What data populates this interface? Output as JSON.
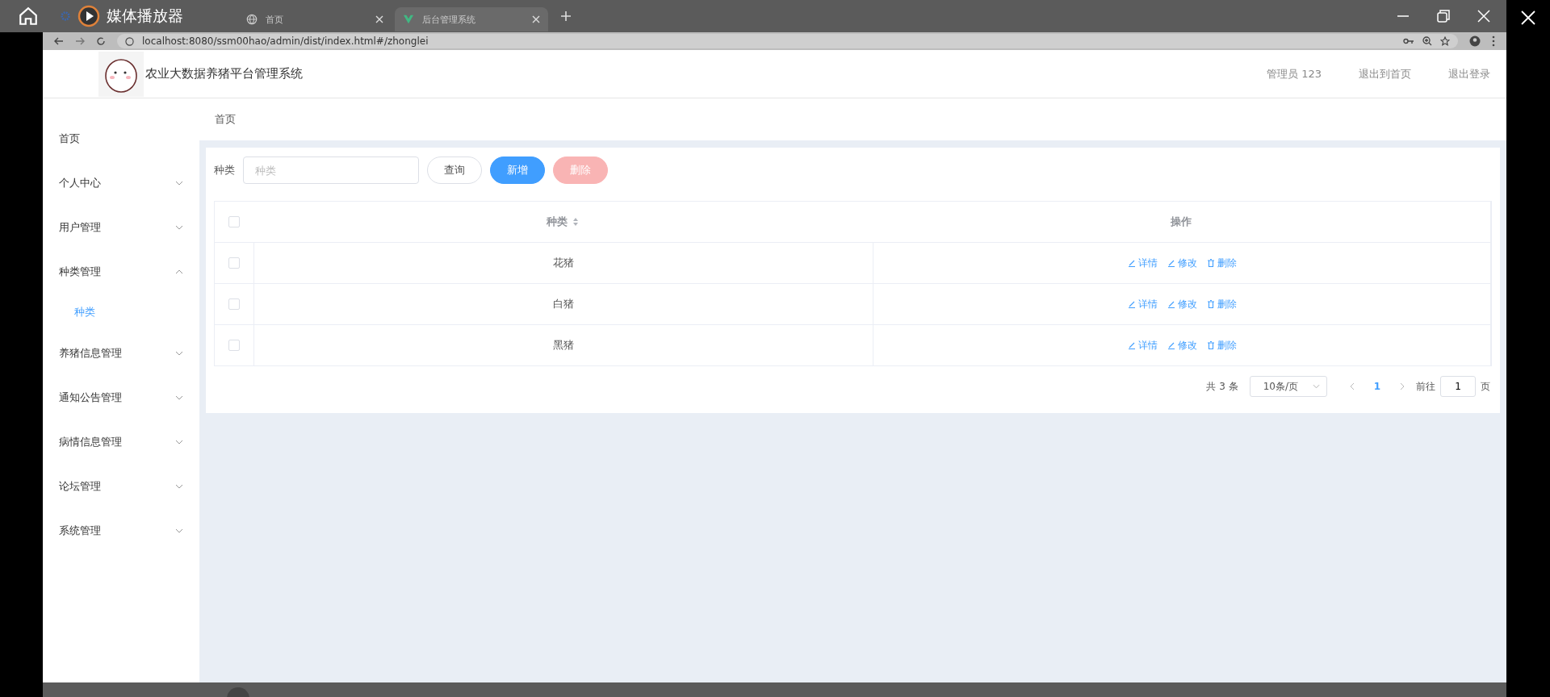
{
  "player": {
    "title": "媒体播放器"
  },
  "browser": {
    "tabs": [
      {
        "label": "首页",
        "selected": false
      },
      {
        "label": "后台管理系统",
        "selected": true
      }
    ],
    "url": "localhost:8080/ssm00hao/admin/dist/index.html#/zhonglei"
  },
  "header": {
    "title": "农业大数据养猪平台管理系统",
    "user": "管理员 123",
    "links": [
      "退出到首页",
      "退出登录"
    ]
  },
  "sidebar": {
    "items": [
      {
        "label": "首页",
        "kind": "link"
      },
      {
        "label": "个人中心",
        "kind": "submenu",
        "expanded": false
      },
      {
        "label": "用户管理",
        "kind": "submenu",
        "expanded": false
      },
      {
        "label": "种类管理",
        "kind": "submenu",
        "expanded": true,
        "children": [
          {
            "label": "种类",
            "selected": true
          }
        ]
      },
      {
        "label": "养猪信息管理",
        "kind": "submenu",
        "expanded": false
      },
      {
        "label": "通知公告管理",
        "kind": "submenu",
        "expanded": false
      },
      {
        "label": "病情信息管理",
        "kind": "submenu",
        "expanded": false
      },
      {
        "label": "论坛管理",
        "kind": "submenu",
        "expanded": false
      },
      {
        "label": "系统管理",
        "kind": "submenu",
        "expanded": false
      }
    ]
  },
  "breadcrumb": [
    "首页"
  ],
  "search": {
    "label": "种类",
    "placeholder": "种类"
  },
  "buttons": [
    {
      "label": "查询",
      "kind": "plain",
      "disabled": false
    },
    {
      "label": "新增",
      "kind": "primary",
      "disabled": false
    },
    {
      "label": "删除",
      "kind": "danger",
      "disabled": true
    }
  ],
  "table": {
    "columns": [
      "种类",
      "操作"
    ],
    "header_checked": false,
    "rows": [
      {
        "name": "花猪",
        "checked": false,
        "actions": [
          "详情",
          "修改",
          "删除"
        ]
      },
      {
        "name": "白猪",
        "checked": false,
        "actions": [
          "详情",
          "修改",
          "删除"
        ]
      },
      {
        "name": "黑猪",
        "checked": false,
        "actions": [
          "详情",
          "修改",
          "删除"
        ]
      }
    ]
  },
  "pagination": {
    "total": "共 3 条",
    "page_size": "10条/页",
    "pages": [
      {
        "label": "1",
        "selected": true
      }
    ],
    "goto_label": "前往",
    "goto_value": "1",
    "goto_suffix": "页"
  }
}
